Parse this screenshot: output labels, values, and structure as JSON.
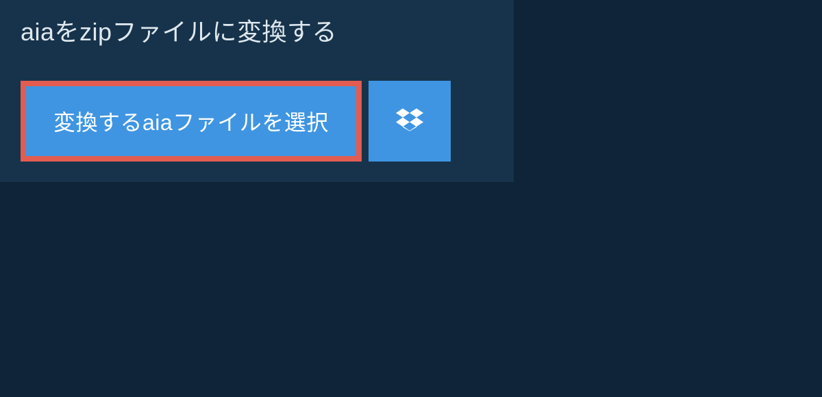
{
  "title": "aiaをzipファイルに変換する",
  "select_button_label": "変換するaiaファイルを選択",
  "icons": {
    "dropbox": "dropbox-icon"
  },
  "colors": {
    "background": "#0f2438",
    "panel": "#17334b",
    "button": "#3f95e2",
    "highlight_border": "#e25c52",
    "text_light": "#dfe8ef",
    "text_white": "#ffffff"
  }
}
